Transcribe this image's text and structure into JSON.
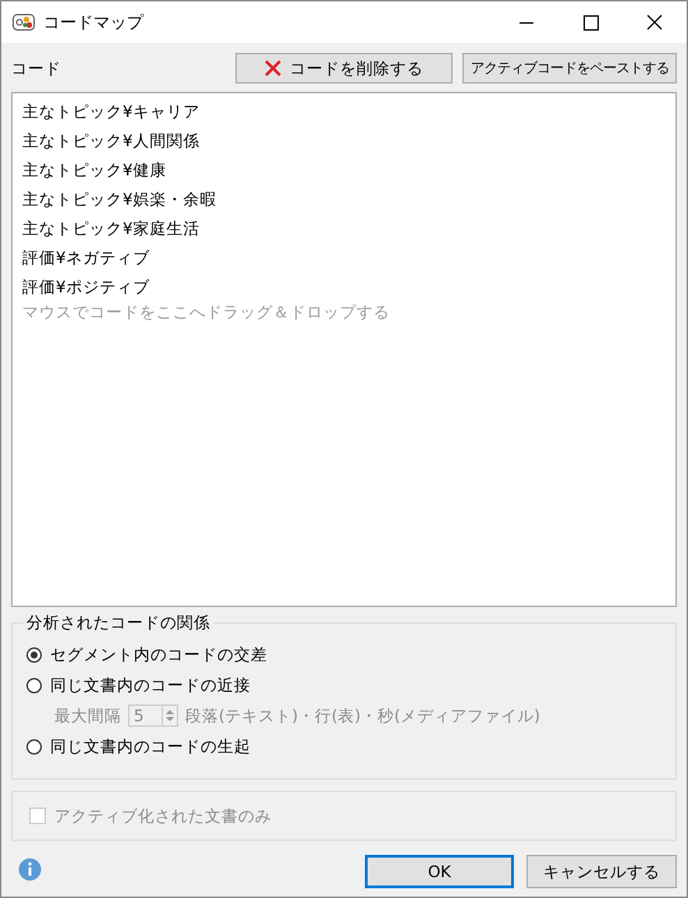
{
  "window": {
    "title": "コードマップ"
  },
  "codes": {
    "label": "コード",
    "delete_button": "コードを削除する",
    "paste_button": "アクティブコードをペーストする",
    "items": [
      "主なトピック¥キャリア",
      "主なトピック¥人間関係",
      "主なトピック¥健康",
      "主なトピック¥娯楽・余暇",
      "主なトピック¥家庭生活",
      "評価¥ネガティブ",
      "評価¥ポジティブ"
    ],
    "drop_hint": "マウスでコードをここへドラッグ＆ドロップする"
  },
  "relation": {
    "legend": "分析されたコードの関係",
    "options": [
      {
        "label": "セグメント内のコードの交差",
        "selected": true
      },
      {
        "label": "同じ文書内のコードの近接",
        "selected": false
      },
      {
        "label": "同じ文書内のコードの生起",
        "selected": false
      }
    ],
    "max_distance": {
      "label": "最大間隔",
      "value": "5",
      "unit": "段落(テキスト)・行(表)・秒(メディアファイル)",
      "disabled": true
    }
  },
  "active_only": {
    "label": "アクティブ化された文書のみ",
    "checked": false,
    "disabled": true
  },
  "buttons": {
    "ok": "OK",
    "cancel": "キャンセルする"
  }
}
